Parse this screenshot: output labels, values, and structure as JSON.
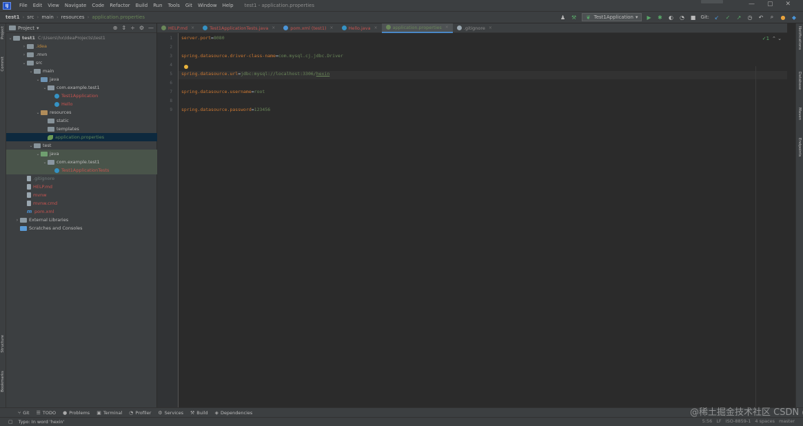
{
  "menubar": {
    "logo": "IJ",
    "items": [
      "File",
      "Edit",
      "View",
      "Navigate",
      "Code",
      "Refactor",
      "Build",
      "Run",
      "Tools",
      "Git",
      "Window",
      "Help"
    ],
    "window_title": "test1 - application.properties",
    "controls": [
      "—",
      "▢",
      "✕"
    ]
  },
  "navbar": {
    "breadcrumbs": [
      "test1",
      "src",
      "main",
      "resources",
      "application.properties"
    ],
    "run_config": "Test1Application",
    "git_label": "Git:"
  },
  "left_stripe": {
    "items": [
      "Project",
      "Commit",
      "Structure",
      "Bookmarks"
    ]
  },
  "right_stripe": {
    "items": [
      "Notifications",
      "Database",
      "Maven",
      "Endpoints"
    ]
  },
  "project_panel": {
    "title": "Project",
    "root_name": "test1",
    "root_path": "C:\\Users\\hx\\IdeaProjects\\test1",
    "tree": [
      {
        "label": ".idea",
        "depth": 2,
        "twisty": "›",
        "icon": "folder",
        "color": "tl-orange"
      },
      {
        "label": ".mvn",
        "depth": 2,
        "twisty": "›",
        "icon": "folder",
        "color": ""
      },
      {
        "label": "src",
        "depth": 2,
        "twisty": "⌄",
        "icon": "folder",
        "color": ""
      },
      {
        "label": "main",
        "depth": 3,
        "twisty": "⌄",
        "icon": "folder",
        "color": ""
      },
      {
        "label": "java",
        "depth": 4,
        "twisty": "⌄",
        "icon": "folder-blue",
        "color": ""
      },
      {
        "label": "com.example.test1",
        "depth": 5,
        "twisty": "⌄",
        "icon": "pkg",
        "color": ""
      },
      {
        "label": "Test1Application",
        "depth": 6,
        "twisty": "",
        "icon": "class",
        "color": "tl-red"
      },
      {
        "label": "Hello",
        "depth": 6,
        "twisty": "",
        "icon": "class",
        "color": "tl-red"
      },
      {
        "label": "resources",
        "depth": 4,
        "twisty": "⌄",
        "icon": "folder-orange",
        "color": ""
      },
      {
        "label": "static",
        "depth": 5,
        "twisty": "",
        "icon": "folder",
        "color": ""
      },
      {
        "label": "templates",
        "depth": 5,
        "twisty": "",
        "icon": "folder",
        "color": ""
      },
      {
        "label": "application.properties",
        "depth": 5,
        "twisty": "",
        "icon": "spring",
        "color": "tl-darkgreen",
        "selected": true
      },
      {
        "label": "test",
        "depth": 3,
        "twisty": "⌄",
        "icon": "folder",
        "color": ""
      },
      {
        "label": "java",
        "depth": 4,
        "twisty": "⌄",
        "icon": "folder-green",
        "color": "",
        "test": true
      },
      {
        "label": "com.example.test1",
        "depth": 5,
        "twisty": "⌄",
        "icon": "pkg",
        "color": "",
        "test": true
      },
      {
        "label": "Test1ApplicationTests",
        "depth": 6,
        "twisty": "",
        "icon": "class",
        "color": "tl-red",
        "test": true
      },
      {
        "label": ".gitignore",
        "depth": 2,
        "twisty": "",
        "icon": "file",
        "color": "tl-dim"
      },
      {
        "label": "HELP.md",
        "depth": 2,
        "twisty": "",
        "icon": "file",
        "color": "tl-red"
      },
      {
        "label": "mvnw",
        "depth": 2,
        "twisty": "",
        "icon": "file",
        "color": "tl-red"
      },
      {
        "label": "mvnw.cmd",
        "depth": 2,
        "twisty": "",
        "icon": "file",
        "color": "tl-red"
      },
      {
        "label": "pom.xml",
        "depth": 2,
        "twisty": "",
        "icon": "maven",
        "color": "tl-red"
      },
      {
        "label": "External Libraries",
        "depth": 1,
        "twisty": "›",
        "icon": "lib",
        "color": ""
      },
      {
        "label": "Scratches and Consoles",
        "depth": 1,
        "twisty": "",
        "icon": "scratch",
        "color": ""
      }
    ]
  },
  "editor": {
    "tabs": [
      {
        "label": "HELP.md",
        "icon_color": "#6a8759",
        "color": "#c75450"
      },
      {
        "label": "Test1ApplicationTests.java",
        "icon_color": "#3592c4",
        "color": "#c75450"
      },
      {
        "label": "pom.xml (test1)",
        "icon_color": "#4b95d8",
        "color": "#c75450"
      },
      {
        "label": "Hello.java",
        "icon_color": "#3592c4",
        "color": "#c75450"
      },
      {
        "label": "application.properties",
        "icon_color": "#6a8759",
        "color": "#6a8759",
        "active": true
      },
      {
        "label": ".gitignore",
        "icon_color": "#9aa7b0",
        "color": "#8c8c8c"
      }
    ],
    "line_numbers": [
      "1",
      "2",
      "3",
      "4",
      "5",
      "6",
      "7",
      "8",
      "9"
    ],
    "lines": [
      {
        "key": "server.port",
        "value": "8080"
      },
      {
        "key": "",
        "value": ""
      },
      {
        "key": "spring.datasource.driver-class-name",
        "value": "com.mysql.cj.jdbc.Driver"
      },
      {
        "key": "",
        "value": ""
      },
      {
        "key": "spring.datasource.url",
        "value": "jdbc:mysql://localhost:3306/",
        "value_underlined": "hexin"
      },
      {
        "key": "",
        "value": ""
      },
      {
        "key": "spring.datasource.username",
        "value": "root"
      },
      {
        "key": "",
        "value": ""
      },
      {
        "key": "spring.datasource.password",
        "value": "123456"
      }
    ],
    "inspection": {
      "ok": "✓1",
      "arrows": "⌃ ⌄"
    }
  },
  "bottom_tools": [
    {
      "icon": "⑂",
      "label": "Git"
    },
    {
      "icon": "☰",
      "label": "TODO"
    },
    {
      "icon": "●",
      "label": "Problems"
    },
    {
      "icon": "▣",
      "label": "Terminal"
    },
    {
      "icon": "◔",
      "label": "Profiler"
    },
    {
      "icon": "⚙",
      "label": "Services"
    },
    {
      "icon": "⚒",
      "label": "Build"
    },
    {
      "icon": "◈",
      "label": "Dependencies"
    }
  ],
  "statusbar": {
    "message": "Typo: In word 'hexin'",
    "position": "5:56",
    "line_sep": "LF",
    "encoding": "ISO-8859-1",
    "indent": "4 spaces",
    "branch": "master"
  },
  "watermark": "@稀土掘金技术社区 CSDN @hexin"
}
